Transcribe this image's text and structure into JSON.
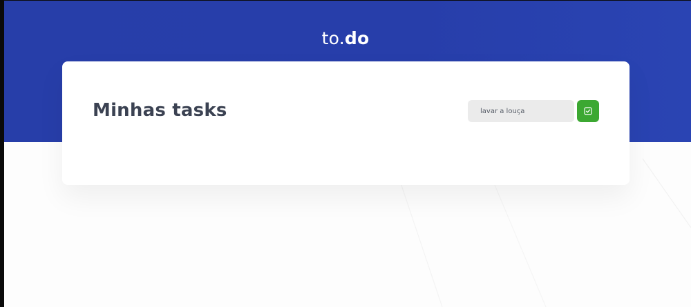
{
  "header": {
    "logo_light": "to.",
    "logo_bold": "do",
    "background_color": "#273EAA"
  },
  "card": {
    "title": "Minhas tasks"
  },
  "task_form": {
    "input_value": "lavar a louça",
    "submit_icon": "check-square-icon",
    "submit_color": "#3CA832"
  }
}
